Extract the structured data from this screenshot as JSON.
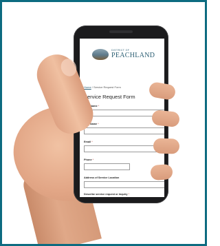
{
  "logo": {
    "small": "DISTRICT OF",
    "big": "PEACHLAND"
  },
  "breadcrumb": {
    "home": "Home",
    "sep": "/",
    "current": "Service Request Form"
  },
  "form": {
    "title": "Service Request Form",
    "fields": [
      {
        "label": "First Name",
        "required": "*",
        "value": ""
      },
      {
        "label": "Last Name",
        "required": "*",
        "value": ""
      },
      {
        "label": "Email",
        "required": "*",
        "value": ""
      },
      {
        "label": "Phone",
        "required": "*",
        "value": ""
      },
      {
        "label": "Address of Service Location",
        "required": "",
        "value": ""
      },
      {
        "label": "Describe service request or inquiry",
        "required": "*",
        "value": ""
      }
    ]
  }
}
